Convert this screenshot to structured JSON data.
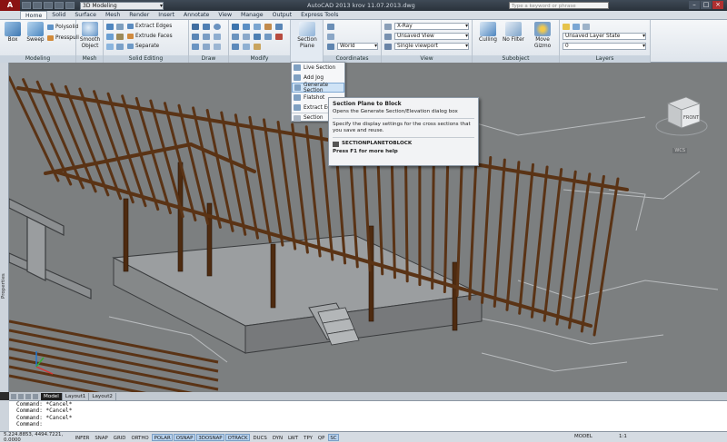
{
  "titlebar": {
    "workspace": "3D Modeling",
    "title": "AutoCAD 2013   krov 11.07.2013.dwg",
    "search_placeholder": "Type a keyword or phrase"
  },
  "tabs": [
    "Home",
    "Solid",
    "Surface",
    "Mesh",
    "Render",
    "Insert",
    "Annotate",
    "View",
    "Manage",
    "Output",
    "Express Tools"
  ],
  "ribbon": {
    "modeling": {
      "title": "Modeling",
      "box": "Box",
      "sweep": "Sweep",
      "polysolid": "Polysolid",
      "presspull": "Presspull"
    },
    "mesh": {
      "title": "Mesh",
      "smooth_object": "Smooth Object"
    },
    "solid_editing": {
      "title": "Solid Editing",
      "extract_edges": "Extract Edges",
      "extrude_faces": "Extrude Faces",
      "separate": "Separate"
    },
    "draw": {
      "title": "Draw"
    },
    "modify": {
      "title": "Modify"
    },
    "section": {
      "label": "Section Plane"
    },
    "coordinates": {
      "title": "Coordinates",
      "world": "World"
    },
    "view": {
      "title": "View",
      "visual_style": "X-Ray",
      "named_view": "Unsaved View",
      "viewport": "Single viewport"
    },
    "subobject": {
      "title": "Subobject",
      "culling": "Culling",
      "no_filter": "No Filter",
      "move_gizmo": "Move Gizmo"
    },
    "layers": {
      "title": "Layers",
      "layer_state": "Unsaved Layer State",
      "current_layer": "0"
    }
  },
  "section_menu": {
    "items": [
      "Live Section",
      "Add Jog",
      "Generate Section",
      "Flatshot",
      "Extract Edges"
    ],
    "footer": "Section"
  },
  "tooltip": {
    "title": "Section Plane to Block",
    "line1": "Opens the Generate Section/Elevation dialog box",
    "line2": "Specify the display settings for the cross sections that you save and reuse.",
    "command": "SECTIONPLANETOBLOCK",
    "help": "Press F1 for more help"
  },
  "viewport": {
    "wcs": "WCS",
    "viewcube_face": "FRONT",
    "properties_label": "Properties"
  },
  "layout_tabs": [
    "Model",
    "Layout1",
    "Layout2"
  ],
  "command_lines": [
    "Command: *Cancel*",
    "Command: *Cancel*",
    "Command: *Cancel*",
    "Command:"
  ],
  "status": {
    "coords": "5.224.8853, 4494.7221, 0.0000",
    "buttons": [
      "INFER",
      "SNAP",
      "GRID",
      "ORTHO",
      "POLAR",
      "OSNAP",
      "3DOSNAP",
      "OTRACK",
      "DUCS",
      "DYN",
      "LWT",
      "TPY",
      "QP",
      "SC"
    ],
    "on_buttons": [
      "POLAR",
      "OSNAP",
      "3DOSNAP",
      "OTRACK",
      "SC"
    ],
    "model": "MODEL",
    "scale": "1:1"
  },
  "colors": {
    "timber": "#5a3315",
    "viewport_bg": "#7c7f80",
    "accent": "#1e79d3"
  }
}
